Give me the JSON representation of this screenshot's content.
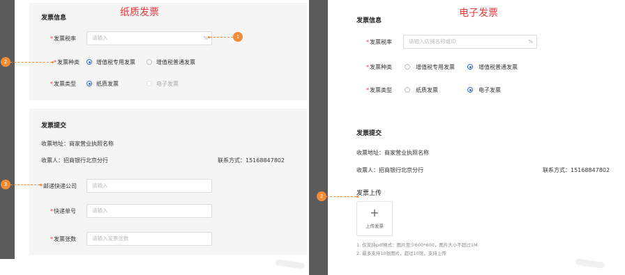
{
  "left": {
    "heading": "纸质发票",
    "invoice_info": {
      "title": "发票信息",
      "tax_rate": {
        "label": "发票税率",
        "placeholder": "请输入",
        "suffix": "%"
      },
      "invoice_kind": {
        "label": "发票种类",
        "options": [
          "增值税专用发票",
          "增值税普通发票"
        ],
        "selected": 0
      },
      "invoice_type": {
        "label": "发票类型",
        "options": [
          "纸质发票",
          "电子发票"
        ],
        "selected": 0
      }
    },
    "submit": {
      "title": "发票提交",
      "address": "收票地址：商家营业执照名称",
      "recipient": "收票人：招商银行北京分行",
      "contact": "联系方式：15168847802",
      "courier": {
        "label": "邮递快递公司",
        "placeholder": "请输入"
      },
      "tracking": {
        "label": "快递单号",
        "placeholder": "请输入"
      },
      "count": {
        "label": "发票张数",
        "placeholder": "请输入发票张数"
      }
    },
    "badges": [
      "1",
      "2",
      "3"
    ]
  },
  "right": {
    "heading": "电子发票",
    "invoice_info": {
      "title": "发票信息",
      "tax_rate": {
        "label": "发票税率",
        "placeholder": "请输入店铺名称或ID",
        "suffix": "%"
      },
      "invoice_kind": {
        "label": "发票种类",
        "options": [
          "增值税专用发票",
          "增值税普通发票"
        ],
        "selected": 1
      },
      "invoice_type": {
        "label": "发票类型",
        "options": [
          "纸质发票",
          "电子发票"
        ],
        "selected": 1
      }
    },
    "submit": {
      "title": "发票提交",
      "address": "收票地址：商家营业执照名称",
      "recipient": "收票人：招商银行北京分行",
      "contact": "联系方式：15168847802",
      "upload_title": "发票上传",
      "upload_plus": "+",
      "upload_label": "上传发票",
      "notes": [
        "1. 仅支持pdf格式：图片至少600*600，图片大小不超过1M",
        "2. 最多支持10张图片，超过10张，支持上传"
      ]
    },
    "badges": [
      "2"
    ]
  },
  "colors": {
    "accent": "#f28c38",
    "required": "#e4393c",
    "radio": "#2f6ee5"
  }
}
